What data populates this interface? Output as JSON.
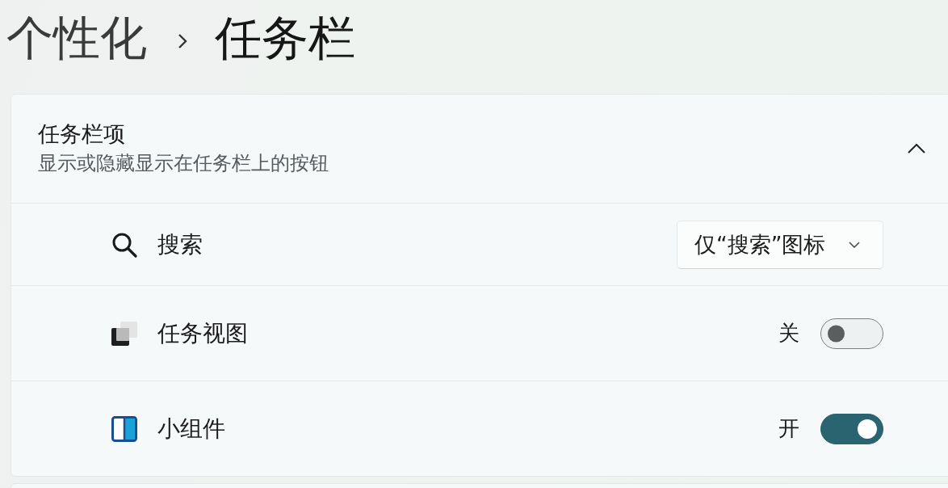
{
  "breadcrumb": {
    "parent": "个性化",
    "current": "任务栏"
  },
  "section": {
    "title": "任务栏项",
    "subtitle": "显示或隐藏显示在任务栏上的按钮",
    "expanded": true,
    "items": [
      {
        "kind": "dropdown",
        "label": "搜索",
        "value": "仅“搜索”图标"
      },
      {
        "kind": "toggle",
        "label": "任务视图",
        "state_label": "关",
        "on": false
      },
      {
        "kind": "toggle",
        "label": "小组件",
        "state_label": "开",
        "on": true
      }
    ]
  }
}
